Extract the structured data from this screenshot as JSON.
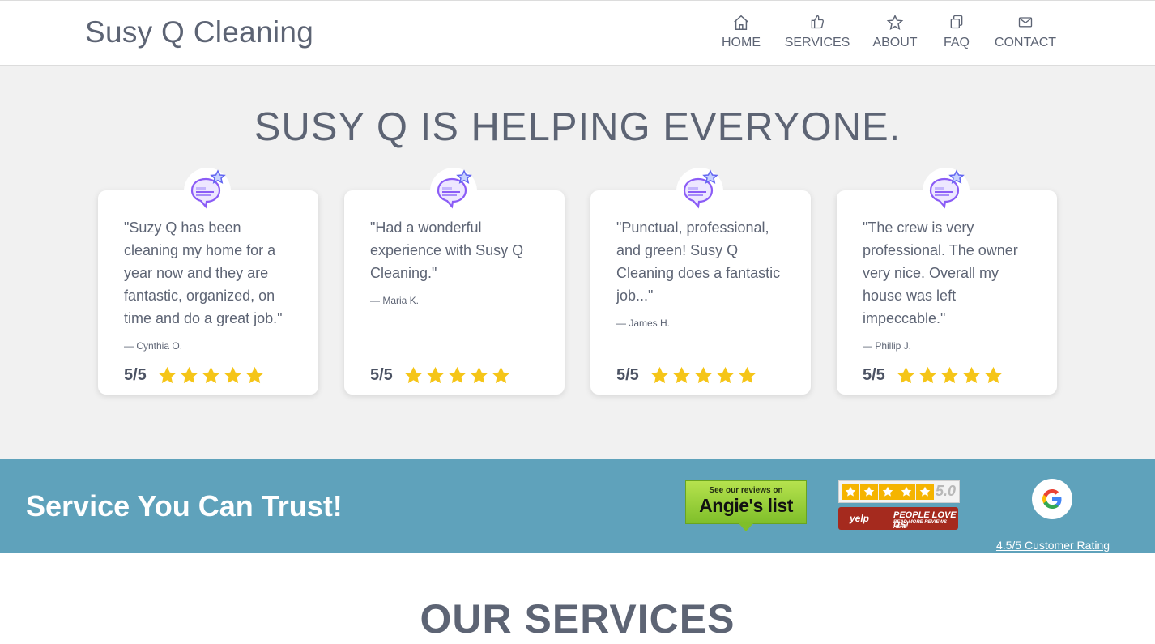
{
  "header": {
    "brand": "Susy Q Cleaning",
    "nav": [
      {
        "label": "HOME",
        "icon": "home-icon"
      },
      {
        "label": "SERVICES",
        "icon": "thumbs-up-icon"
      },
      {
        "label": "ABOUT",
        "icon": "star-icon"
      },
      {
        "label": "FAQ",
        "icon": "copy-icon"
      },
      {
        "label": "CONTACT",
        "icon": "mail-icon"
      }
    ]
  },
  "reviews": {
    "title": "SUSY Q IS HELPING EVERYONE.",
    "badge_icon": "review-chat-icon",
    "star_color": "#f5c518",
    "items": [
      {
        "quote": "\"Suzy Q has been cleaning my home for a year now and they are fantastic, organized, on time and do a great job.\"",
        "author": "— Cynthia O.",
        "score": "5/5",
        "stars": 5
      },
      {
        "quote": "\"Had a wonderful experience with Susy Q Cleaning.\"",
        "author": "— Maria K.",
        "score": "5/5",
        "stars": 5
      },
      {
        "quote": "\"Punctual, professional, and green! Susy Q Cleaning does a fantastic job...\"",
        "author": "— James H.",
        "score": "5/5",
        "stars": 5
      },
      {
        "quote": "\"The crew is very professional. The owner very nice. Overall my house was left impeccable.\"",
        "author": "— Phillip J.",
        "score": "5/5",
        "stars": 5
      }
    ]
  },
  "trust": {
    "title": "Service You Can Trust!",
    "background_color": "#5fa2bb",
    "angies": {
      "line1": "See our reviews on",
      "line2": "Angie's list"
    },
    "yelp": {
      "score": "5.0",
      "logo": "yelp",
      "love": "PEOPLE LOVE US!",
      "more": "READ MORE REVIEWS HERE"
    },
    "google": {
      "icon": "google-icon",
      "label": "4.5/5 Customer Rating"
    }
  },
  "services": {
    "title": "OUR SERVICES"
  }
}
